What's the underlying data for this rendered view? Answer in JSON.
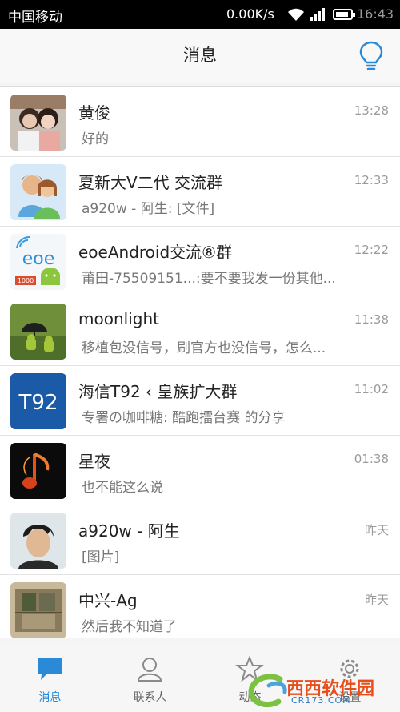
{
  "status": {
    "carrier": "中国移动",
    "speed": "0.00K/s",
    "time": "16:43"
  },
  "header": {
    "title": "消息"
  },
  "conversations": [
    {
      "name": "黄俊",
      "message": "好的",
      "time": "13:28"
    },
    {
      "name": "夏新大V二代 交流群",
      "message": "a920w - 阿生: [文件]",
      "time": "12:33"
    },
    {
      "name": "eoeAndroid交流⑧群",
      "message": "莆田-75509151...:要不要我发一份其他...",
      "time": "12:22"
    },
    {
      "name": "moonlight",
      "message": "移植包没信号，刷官方也没信号，怎么...",
      "time": "11:38"
    },
    {
      "name": "海信T92 ‹ 皇族扩大群",
      "message": "专署の咖啡糖: 酷跑擂台赛 的分享",
      "time": "11:02"
    },
    {
      "name": "星夜",
      "message": "也不能这么说",
      "time": "01:38"
    },
    {
      "name": "a920w - 阿生",
      "message": "[图片]",
      "time": "昨天"
    },
    {
      "name": "中兴-Ag",
      "message": "然后我不知道了",
      "time": "昨天"
    }
  ],
  "avatars": {
    "t92": "T92",
    "eoe": "eoe",
    "eoe_sub": "1000"
  },
  "tabs": [
    {
      "label": "消息",
      "icon": "chat-bubble-icon"
    },
    {
      "label": "联系人",
      "icon": "person-icon"
    },
    {
      "label": "动态",
      "icon": "star-icon"
    },
    {
      "label": "设置",
      "icon": "gear-icon"
    }
  ],
  "watermark": {
    "brand": "西西软件园",
    "domain": "CR173.COM"
  },
  "colors": {
    "accent": "#2a8ad8",
    "statusbar": "#000000",
    "header": "#f8f8f8"
  }
}
